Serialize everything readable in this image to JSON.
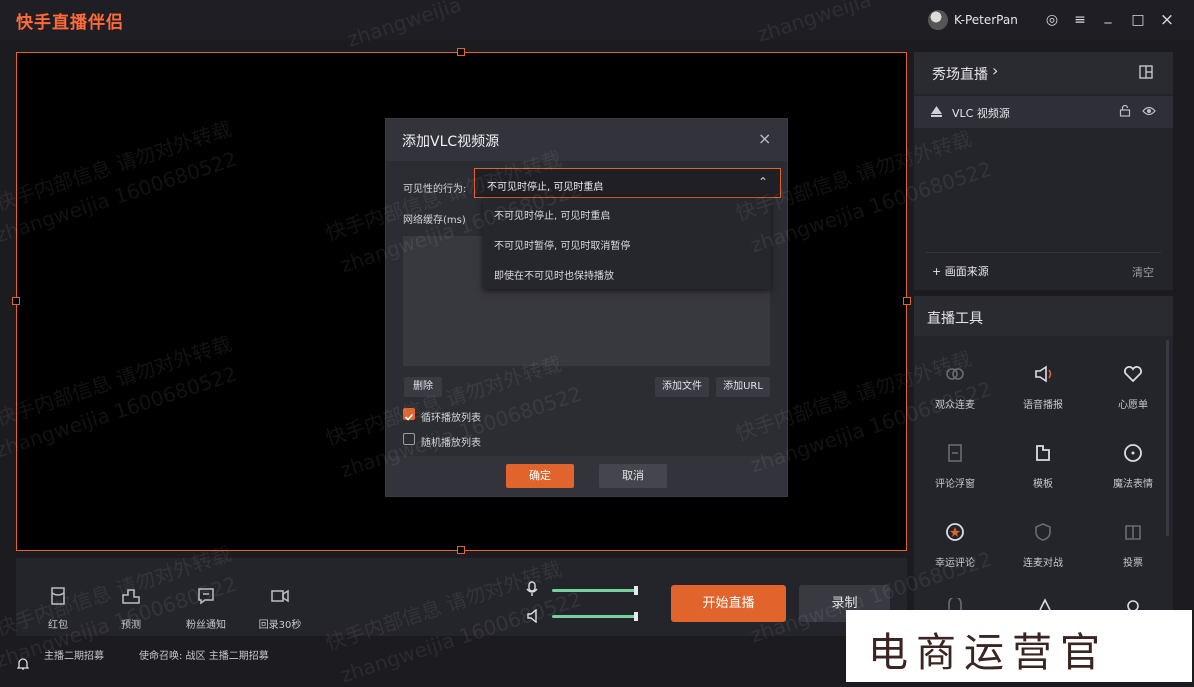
{
  "app": {
    "title": "快手直播伴侣"
  },
  "user": {
    "name": "K-PeterPan"
  },
  "window_controls": {
    "settings": "◎",
    "menu": "≡",
    "minimize": "_",
    "maximize": "□",
    "close": "×"
  },
  "right_panel": {
    "scene_title": "秀场直播",
    "scene_chevron": "›",
    "source_name": "VLC 视频源",
    "add_source": "+ 画面来源",
    "clear": "清空",
    "tools_title": "直播工具",
    "tools": [
      {
        "label": "观众连麦"
      },
      {
        "label": "语音播报"
      },
      {
        "label": "心愿单"
      },
      {
        "label": "评论浮窗"
      },
      {
        "label": "模板"
      },
      {
        "label": "魔法表情"
      },
      {
        "label": "幸运评论"
      },
      {
        "label": "连麦对战"
      },
      {
        "label": "投票"
      }
    ]
  },
  "dialog": {
    "title": "添加VLC视频源",
    "close": "×",
    "visibility_label": "可见性的行为:",
    "visibility_value": "不可见时停止, 可见时重启",
    "chevron": "⌃",
    "options": [
      "不可见时停止, 可见时重启",
      "不可见时暂停, 可见时取消暂停",
      "即使在不可见时也保持播放"
    ],
    "cache_label": "网络缓存(ms)",
    "delete": "删除",
    "add_file": "添加文件",
    "add_url": "添加URL",
    "loop_label": "循环播放列表",
    "loop_checked": true,
    "shuffle_label": "随机播放列表",
    "shuffle_checked": false,
    "confirm": "确定",
    "cancel": "取消"
  },
  "bottom_bar": {
    "tools": [
      {
        "label": "红包"
      },
      {
        "label": "预测"
      },
      {
        "label": "粉丝通知"
      },
      {
        "label": "回录30秒"
      }
    ],
    "start_live": "开始直播",
    "record": "录制"
  },
  "footer": {
    "item1": "主播二期招募",
    "item2": "使命召唤: 战区 主播二期招募"
  },
  "watermark": {
    "line1": "快手内部信息 请勿对外转载",
    "line2": "zhangweijia 1600680522",
    "short": "zhangweijia"
  },
  "brand_overlay": "电商运营官",
  "colors": {
    "accent": "#e0642c",
    "slider": "#77d0a0"
  }
}
